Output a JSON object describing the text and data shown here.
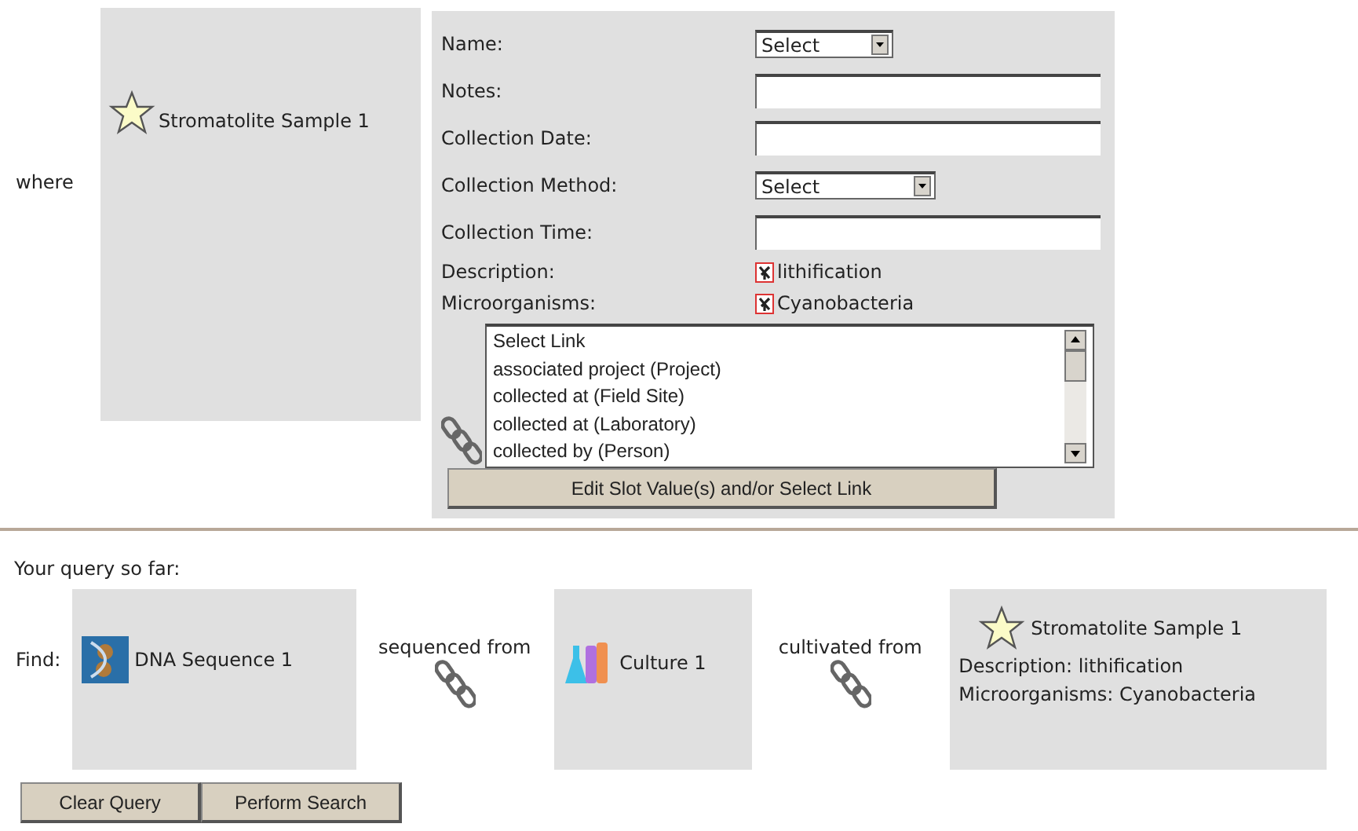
{
  "where_label": "where",
  "subject": {
    "name": "Stromatolite Sample 1"
  },
  "slots": [
    {
      "kind": "select",
      "label": "Name:",
      "value": "Select"
    },
    {
      "kind": "text",
      "label": "Notes:"
    },
    {
      "kind": "text",
      "label": "Collection Date:"
    },
    {
      "kind": "select",
      "label": "Collection Method:",
      "value": "Select"
    },
    {
      "kind": "text",
      "label": "Collection Time:"
    },
    {
      "kind": "value",
      "label": "Description:",
      "value": "lithification"
    },
    {
      "kind": "value",
      "label": "Microorganisms:",
      "value": "Cyanobacteria"
    }
  ],
  "link_list": [
    "Select Link",
    "associated project (Project)",
    "collected at (Field Site)",
    "collected at (Laboratory)",
    "collected by (Person)"
  ],
  "edit_button": "Edit Slot Value(s) and/or Select Link",
  "query_heading": "Your query so far:",
  "find_label": "Find:",
  "query": [
    {
      "kind": "node",
      "name": "DNA Sequence 1"
    },
    {
      "kind": "link",
      "label": "sequenced from"
    },
    {
      "kind": "node",
      "name": "Culture 1"
    },
    {
      "kind": "link",
      "label": "cultivated from"
    },
    {
      "kind": "node",
      "name": "Stromatolite Sample 1",
      "details": [
        "Description: lithification",
        "Microorganisms: Cyanobacteria"
      ]
    }
  ],
  "buttons": [
    "Clear Query",
    "Perform Search"
  ]
}
